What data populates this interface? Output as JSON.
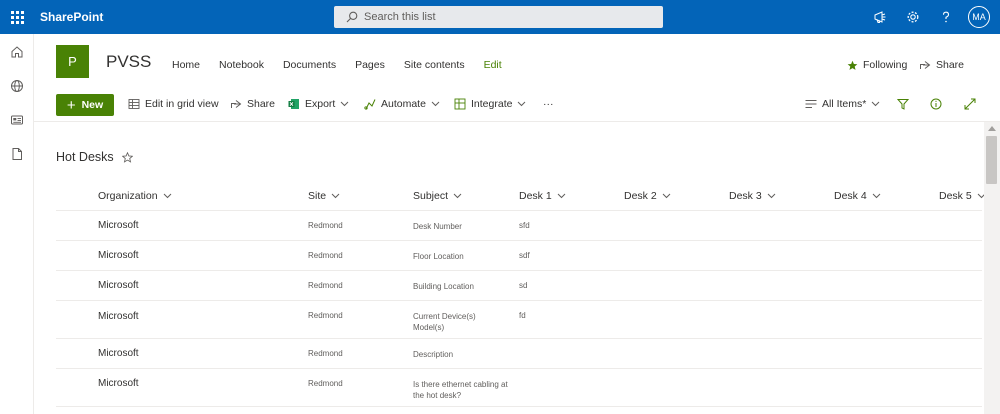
{
  "suite": {
    "brand": "SharePoint",
    "search_placeholder": "Search this list",
    "user_initials": "MA"
  },
  "site": {
    "logo_letter": "P",
    "title": "PVSS",
    "nav": [
      "Home",
      "Notebook",
      "Documents",
      "Pages",
      "Site contents",
      "Edit"
    ],
    "following_label": "Following",
    "share_label": "Share"
  },
  "commands": {
    "new_label": "New",
    "grid_view_label": "Edit in grid view",
    "share_label": "Share",
    "export_label": "Export",
    "automate_label": "Automate",
    "integrate_label": "Integrate",
    "more_label": "···",
    "view_label": "All Items*"
  },
  "list": {
    "title": "Hot Desks",
    "columns": [
      "Organization",
      "Site",
      "Subject",
      "Desk 1",
      "Desk 2",
      "Desk 3",
      "Desk 4",
      "Desk 5"
    ],
    "rows": [
      {
        "org": "Microsoft",
        "site": "Redmond",
        "subject": "Desk Number",
        "desk1": "sfd"
      },
      {
        "org": "Microsoft",
        "site": "Redmond",
        "subject": "Floor Location",
        "desk1": "sdf"
      },
      {
        "org": "Microsoft",
        "site": "Redmond",
        "subject": "Building Location",
        "desk1": "sd"
      },
      {
        "org": "Microsoft",
        "site": "Redmond",
        "subject": "Current Device(s) Model(s)",
        "desk1": "fd"
      },
      {
        "org": "Microsoft",
        "site": "Redmond",
        "subject": "Description",
        "desk1": ""
      },
      {
        "org": "Microsoft",
        "site": "Redmond",
        "subject": "Is there ethernet cabling at the hot desk?",
        "desk1": ""
      }
    ]
  },
  "colors": {
    "suite_bar": "#0364b8",
    "accent_green": "#498205"
  }
}
